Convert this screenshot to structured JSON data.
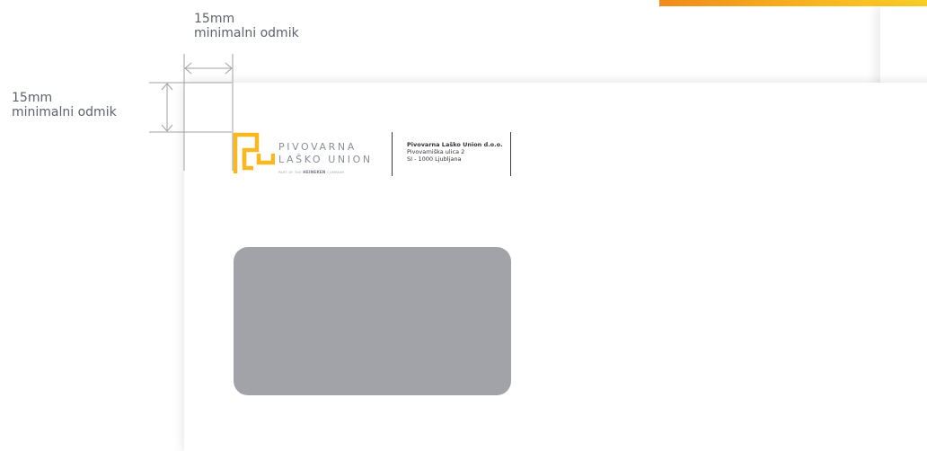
{
  "dimensions": {
    "horizontal": {
      "value": "15mm",
      "label": "minimalni odmik"
    },
    "vertical": {
      "value": "15mm",
      "label": "minimalni odmik"
    }
  },
  "brand": {
    "line1": "PIVOVARNA",
    "line2": "LAŠKO UNION",
    "tagline_prefix": "PART OF THE",
    "tagline_brand": "HEINEKEN",
    "tagline_suffix": "COMPANY"
  },
  "address": {
    "company": "Pivovarna Laško Union d.o.o.",
    "street": "Pivovarniška ulica 2",
    "city": "SI - 1000 Ljubljana"
  },
  "colors": {
    "logo_yellow": "#f9b81f",
    "accent_orange": "#f08a1c",
    "window_gray": "#a1a3a9"
  }
}
